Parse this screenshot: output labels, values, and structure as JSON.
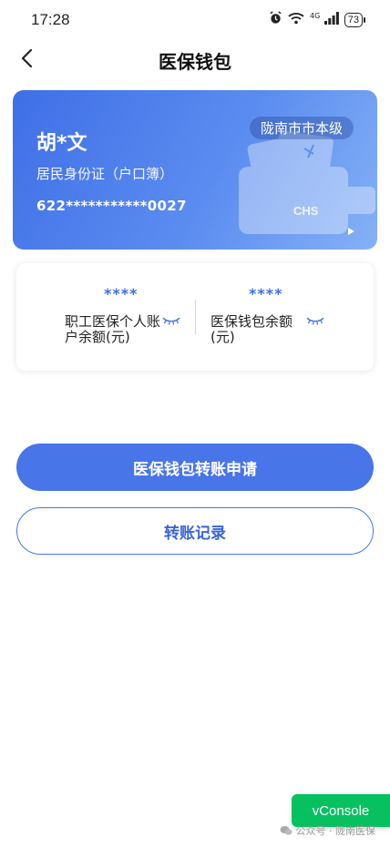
{
  "status_bar": {
    "time": "17:28",
    "network": "4G",
    "battery": "73"
  },
  "nav": {
    "title": "医保钱包"
  },
  "card": {
    "name": "胡*文",
    "id_type": "居民身份证（户口簿）",
    "number": "622***********0027",
    "region": "陇南市市本级",
    "logo_text": "CHS"
  },
  "balances": [
    {
      "value": "****",
      "label": "职工医保个人账户余额(元)"
    },
    {
      "value": "****",
      "label": "医保钱包余额(元)"
    }
  ],
  "actions": {
    "transfer_apply": "医保钱包转账申请",
    "transfer_record": "转账记录"
  },
  "overlay": {
    "vconsole": "vConsole",
    "watermark": "公众号 · 陇南医保"
  },
  "colors": {
    "accent": "#4875e8",
    "card_gradient_start": "#3f6fe6",
    "card_gradient_end": "#86b1f6",
    "vconsole": "#07c160"
  }
}
